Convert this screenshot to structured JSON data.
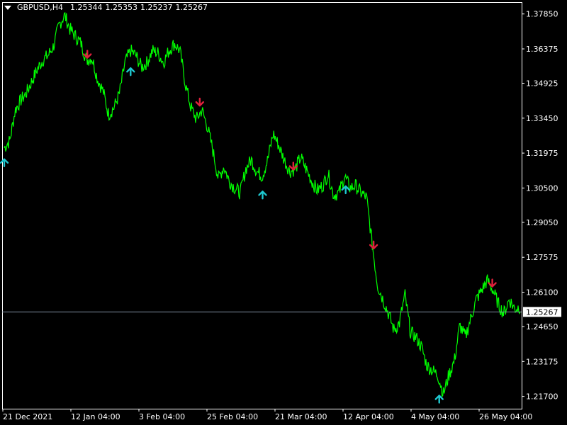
{
  "header": {
    "symbol_tf": "GBPUSD,H4",
    "open": "1.25344",
    "high": "1.25353",
    "low": "1.25237",
    "close": "1.25267"
  },
  "colors": {
    "background": "#000000",
    "line": "#00ff00",
    "up_arrow": "#1ec8d0",
    "down_arrow": "#e0203c",
    "price_line": "#7f8fa0",
    "axis_text": "#ffffff",
    "label_box": "#ffffff"
  },
  "chart_data": {
    "type": "line",
    "ylim": [
      1.2118,
      1.3835
    ],
    "y_ticks": [
      "1.37850",
      "1.36375",
      "1.34925",
      "1.33450",
      "1.31975",
      "1.30500",
      "1.29050",
      "1.27575",
      "1.26100",
      "1.24650",
      "1.23175",
      "1.21700"
    ],
    "x_ticks": [
      "21 Dec 2021",
      "12 Jan 04:00",
      "3 Feb 04:00",
      "25 Feb 04:00",
      "21 Mar 04:00",
      "12 Apr 04:00",
      "4 May 04:00",
      "26 May 04:00"
    ],
    "current_price": "1.25267",
    "current_value": 1.25267,
    "n_bars": 740,
    "series": [
      {
        "values": [
          1.322,
          1.325,
          1.338,
          1.342,
          1.345,
          1.35,
          1.355,
          1.359,
          1.361,
          1.365,
          1.374,
          1.378,
          1.372,
          1.369,
          1.366,
          1.359,
          1.36,
          1.351,
          1.346,
          1.336,
          1.339,
          1.345,
          1.358,
          1.363,
          1.361,
          1.356,
          1.358,
          1.363,
          1.362,
          1.358,
          1.363,
          1.366,
          1.363,
          1.349,
          1.339,
          1.334,
          1.338,
          1.331,
          1.321,
          1.309,
          1.314,
          1.308,
          1.305,
          1.303,
          1.313,
          1.317,
          1.312,
          1.31,
          1.317,
          1.328,
          1.323,
          1.317,
          1.312,
          1.313,
          1.318,
          1.313,
          1.308,
          1.304,
          1.306,
          1.311,
          1.302,
          1.303,
          1.31,
          1.305,
          1.306,
          1.303,
          1.301,
          1.282,
          1.264,
          1.258,
          1.252,
          1.245,
          1.248,
          1.26,
          1.244,
          1.242,
          1.238,
          1.23,
          1.228,
          1.226,
          1.218,
          1.226,
          1.232,
          1.247,
          1.242,
          1.25,
          1.258,
          1.262,
          1.266,
          1.262,
          1.256,
          1.252,
          1.258,
          1.254,
          1.255
        ]
      }
    ],
    "up_arrows": [
      0,
      181,
      370,
      489,
      623
    ],
    "down_arrows": [
      119,
      280,
      414,
      529,
      699
    ]
  }
}
